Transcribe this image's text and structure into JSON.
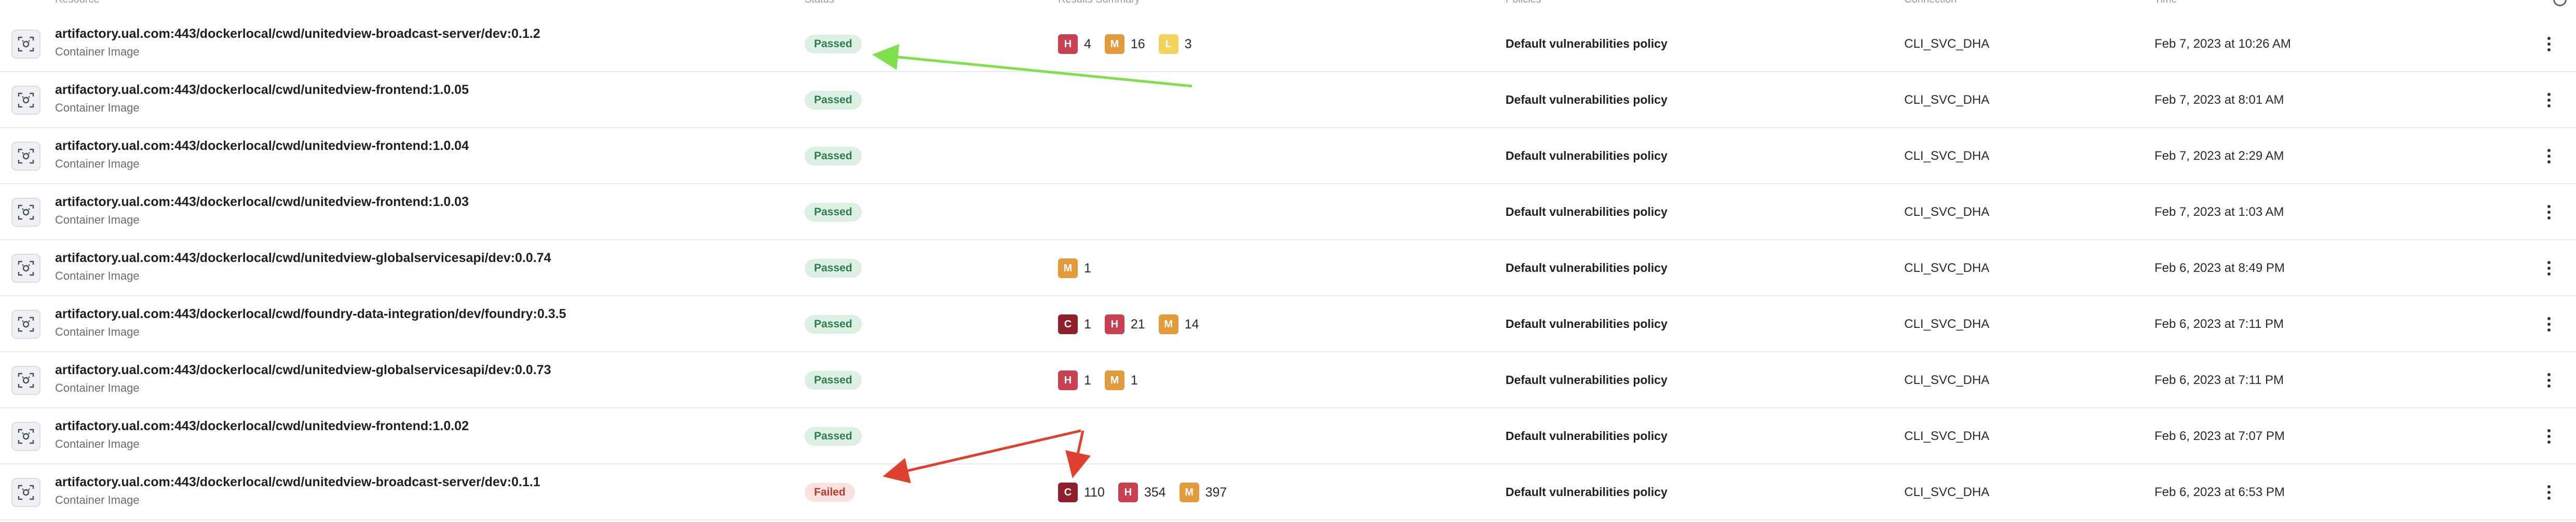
{
  "header": {
    "resource": "Resource",
    "status": "Status",
    "findings": "Results Summary",
    "policy": "Policies",
    "source": "Connection",
    "time": "Time"
  },
  "colors": {
    "critical": "#8e1f2b",
    "high": "#c94150",
    "medium": "#e39a3b",
    "low": "#f2d35c",
    "passed_bg": "#dcefe3",
    "passed_fg": "#2e7d4f",
    "failed_bg": "#fbe1e1",
    "failed_fg": "#c0392b",
    "green_arrow": "#7ee04a",
    "red_arrow": "#e0402e"
  },
  "rows": [
    {
      "name": "artifactory.ual.com:443/dockerlocal/cwd/unitedview-broadcast-server/dev:0.1.2",
      "type": "Container Image",
      "status": "Passed",
      "findings": [
        {
          "sev": "H",
          "count": "4"
        },
        {
          "sev": "M",
          "count": "16"
        },
        {
          "sev": "L",
          "count": "3"
        }
      ],
      "policy": "Default vulnerabilities policy",
      "source": "CLI_SVC_DHA",
      "time": "Feb 7, 2023 at 10:26 AM"
    },
    {
      "name": "artifactory.ual.com:443/dockerlocal/cwd/unitedview-frontend:1.0.05",
      "type": "Container Image",
      "status": "Passed",
      "findings": [],
      "policy": "Default vulnerabilities policy",
      "source": "CLI_SVC_DHA",
      "time": "Feb 7, 2023 at 8:01 AM"
    },
    {
      "name": "artifactory.ual.com:443/dockerlocal/cwd/unitedview-frontend:1.0.04",
      "type": "Container Image",
      "status": "Passed",
      "findings": [],
      "policy": "Default vulnerabilities policy",
      "source": "CLI_SVC_DHA",
      "time": "Feb 7, 2023 at 2:29 AM"
    },
    {
      "name": "artifactory.ual.com:443/dockerlocal/cwd/unitedview-frontend:1.0.03",
      "type": "Container Image",
      "status": "Passed",
      "findings": [],
      "policy": "Default vulnerabilities policy",
      "source": "CLI_SVC_DHA",
      "time": "Feb 7, 2023 at 1:03 AM"
    },
    {
      "name": "artifactory.ual.com:443/dockerlocal/cwd/unitedview-globalservicesapi/dev:0.0.74",
      "type": "Container Image",
      "status": "Passed",
      "findings": [
        {
          "sev": "M",
          "count": "1"
        }
      ],
      "policy": "Default vulnerabilities policy",
      "source": "CLI_SVC_DHA",
      "time": "Feb 6, 2023 at 8:49 PM"
    },
    {
      "name": "artifactory.ual.com:443/dockerlocal/cwd/foundry-data-integration/dev/foundry:0.3.5",
      "type": "Container Image",
      "status": "Passed",
      "findings": [
        {
          "sev": "C",
          "count": "1"
        },
        {
          "sev": "H",
          "count": "21"
        },
        {
          "sev": "M",
          "count": "14"
        }
      ],
      "policy": "Default vulnerabilities policy",
      "source": "CLI_SVC_DHA",
      "time": "Feb 6, 2023 at 7:11 PM"
    },
    {
      "name": "artifactory.ual.com:443/dockerlocal/cwd/unitedview-globalservicesapi/dev:0.0.73",
      "type": "Container Image",
      "status": "Passed",
      "findings": [
        {
          "sev": "H",
          "count": "1"
        },
        {
          "sev": "M",
          "count": "1"
        }
      ],
      "policy": "Default vulnerabilities policy",
      "source": "CLI_SVC_DHA",
      "time": "Feb 6, 2023 at 7:11 PM"
    },
    {
      "name": "artifactory.ual.com:443/dockerlocal/cwd/unitedview-frontend:1.0.02",
      "type": "Container Image",
      "status": "Passed",
      "findings": [],
      "policy": "Default vulnerabilities policy",
      "source": "CLI_SVC_DHA",
      "time": "Feb 6, 2023 at 7:07 PM"
    },
    {
      "name": "artifactory.ual.com:443/dockerlocal/cwd/unitedview-broadcast-server/dev:0.1.1",
      "type": "Container Image",
      "status": "Failed",
      "findings": [
        {
          "sev": "C",
          "count": "110"
        },
        {
          "sev": "H",
          "count": "354"
        },
        {
          "sev": "M",
          "count": "397"
        }
      ],
      "policy": "Default vulnerabilities policy",
      "source": "CLI_SVC_DHA",
      "time": "Feb 6, 2023 at 6:53 PM"
    }
  ]
}
